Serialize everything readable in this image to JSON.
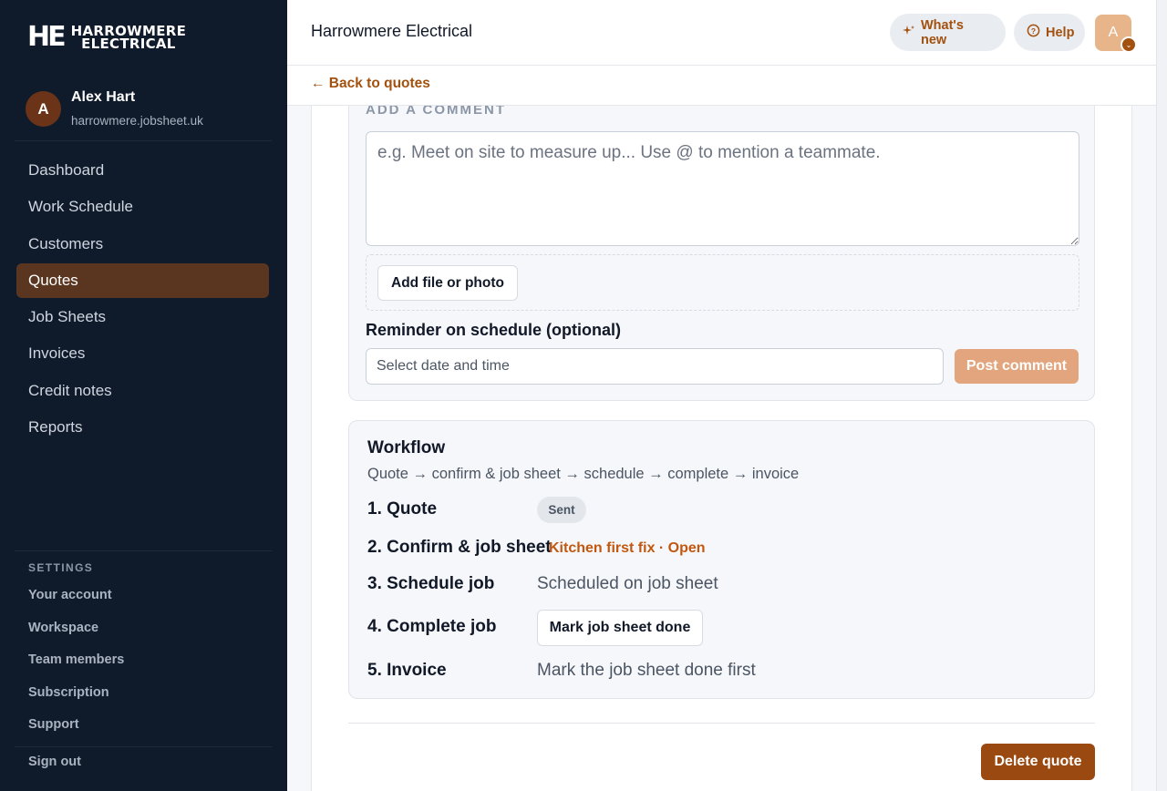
{
  "brand": {
    "logo_mark": "HE",
    "logo_line1": "HARROWMERE",
    "logo_line2": "ELECTRICAL"
  },
  "user": {
    "initial": "A",
    "name": "Alex Hart",
    "host": "harrowmere.jobsheet.uk"
  },
  "nav": [
    {
      "label": "Dashboard"
    },
    {
      "label": "Work Schedule"
    },
    {
      "label": "Customers"
    },
    {
      "label": "Quotes",
      "active": true
    },
    {
      "label": "Job Sheets"
    },
    {
      "label": "Invoices"
    },
    {
      "label": "Credit notes"
    },
    {
      "label": "Reports"
    }
  ],
  "settings": {
    "title": "SETTINGS",
    "items": [
      "Your account",
      "Workspace",
      "Team members",
      "Subscription",
      "Support"
    ],
    "sign_out": "Sign out"
  },
  "header": {
    "company": "Harrowmere Electrical",
    "whats_new": "What's new",
    "help": "Help",
    "avatar_initial": "A"
  },
  "back_link": "← Back to quotes",
  "comment": {
    "label": "ADD A COMMENT",
    "placeholder": "e.g. Meet on site to measure up... Use @ to mention a teammate.",
    "add_file": "Add file or photo",
    "reminder_label": "Reminder on schedule (optional)",
    "date_placeholder": "Select date and time",
    "post": "Post comment"
  },
  "workflow": {
    "title": "Workflow",
    "subtitle": "Quote → confirm & job sheet → schedule → complete → invoice",
    "steps": [
      {
        "label": "1. Quote",
        "status": "Sent"
      },
      {
        "label": "2. Confirm & job sheet",
        "status": "Kitchen first fix · Open"
      },
      {
        "label": "3. Schedule job",
        "status": "Scheduled on job sheet"
      },
      {
        "label": "4. Complete job",
        "status": "Mark job sheet done"
      },
      {
        "label": "5. Invoice",
        "status": "Mark the job sheet done first"
      }
    ]
  },
  "delete": "Delete quote",
  "colors": {
    "sidebar": "#0f1a2b",
    "accent": "#a3510f",
    "active_nav": "#5a3620"
  }
}
